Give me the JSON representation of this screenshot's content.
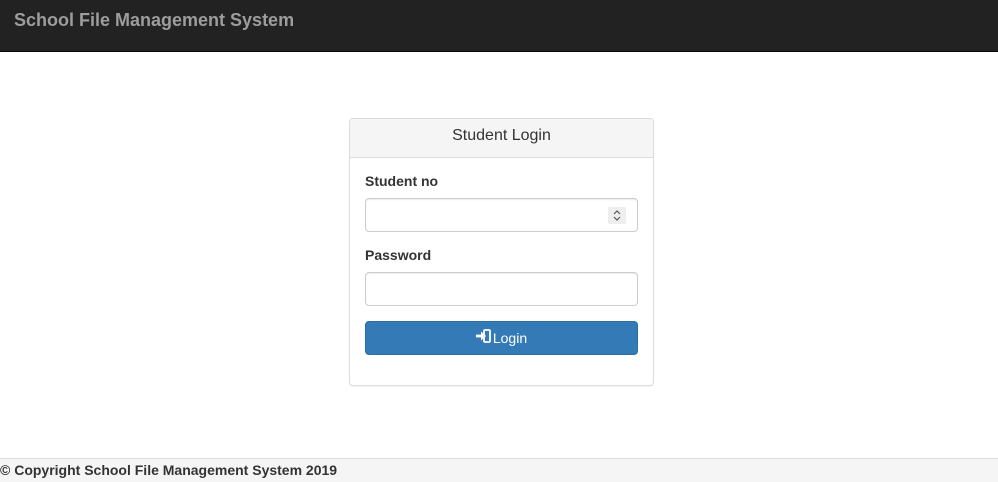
{
  "navbar": {
    "brand": "School File Management System"
  },
  "login_panel": {
    "title": "Student Login",
    "student_no_label": "Student no",
    "student_no_value": "",
    "password_label": "Password",
    "password_value": "",
    "login_button_label": "Login",
    "login_icon": "log-in-icon",
    "spinner_icon": "spinner-arrows-icon"
  },
  "footer": {
    "copyright": "© Copyright School File Management System 2019"
  },
  "colors": {
    "navbar_bg": "#222222",
    "brand_text": "#9d9d9d",
    "primary_button": "#337ab7",
    "panel_heading_bg": "#f5f5f5"
  }
}
